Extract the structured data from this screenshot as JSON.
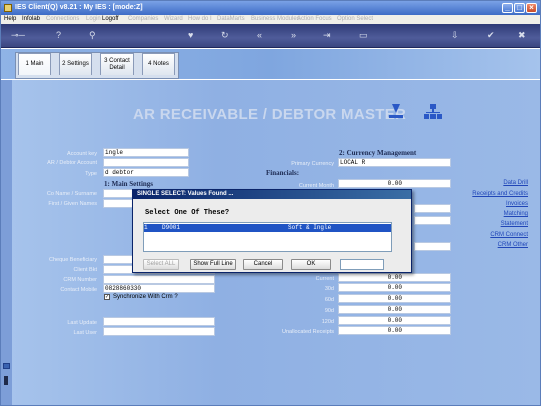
{
  "window": {
    "title": "IES Client(Q) v8.21 : My IES :     [mode:Z]"
  },
  "menu": {
    "items": [
      {
        "label": "Help",
        "enabled": true
      },
      {
        "label": "Infolab",
        "enabled": true
      },
      {
        "label": "Connections",
        "enabled": false
      },
      {
        "label": "Login",
        "enabled": false
      },
      {
        "label": "Logoff",
        "enabled": true
      },
      {
        "label": "Companies",
        "enabled": false
      },
      {
        "label": "Wizard",
        "enabled": false
      },
      {
        "label": "How do I",
        "enabled": false
      },
      {
        "label": "DataMarts",
        "enabled": false
      },
      {
        "label": "Business Modules",
        "enabled": false
      },
      {
        "label": "Action Focus",
        "enabled": false
      },
      {
        "label": "Option Select",
        "enabled": false
      }
    ]
  },
  "tabs": [
    {
      "label": "1 Main"
    },
    {
      "label": "2 Settings"
    },
    {
      "label": "3 Contact Detail"
    },
    {
      "label": "4 Notes"
    }
  ],
  "page": {
    "title": "AR RECEIVABLE / DEBTOR MASTER"
  },
  "left": {
    "account_key_label": "Account key",
    "account_key_value": "ingle",
    "debtor_account_label": "AR / Debtor Account",
    "type_label": "Type",
    "type_value": "d debtor",
    "section_main": "1: Main Settings",
    "co_name_label": "Co Name / Surname",
    "first_name_label": "First / Given Names",
    "cheque_beneficiary_label": "Cheque Beneficiary",
    "client_bkt_label": "Client Bkt",
    "crm_number_label": "CRM Number",
    "contact_mobile_label": "Contact Mobile",
    "contact_mobile_value": "0828860330",
    "sync_crm_label": "Synchronize With Crm ?",
    "sync_crm_checked": true,
    "last_update_label": "Last Update",
    "last_user_label": "Last User"
  },
  "right": {
    "section_currency": "2: Currency Management",
    "primary_currency_label": "Primary Currency",
    "primary_currency_value": "LOCAL R",
    "section_financials": "Financials:",
    "current_month_label": "Current Month",
    "current_month_value": "0.00",
    "current_label": "Current",
    "current_value": "0.00",
    "d30_label": "30d",
    "d30_value": "0.00",
    "d60_label": "60d",
    "d60_value": "0.00",
    "d90_label": "90d",
    "d90_value": "0.00",
    "d120_label": "120d",
    "d120_value": "0.00",
    "unallocated_label": "Unallocated Receipts",
    "unallocated_value": "0.00"
  },
  "links": [
    "Data Drill",
    "Receipts and Credits",
    "Invoices",
    "Matching",
    "Statement",
    "CRM Connect",
    "CRM Other"
  ],
  "dialog": {
    "title": "SINGLE SELECT: Values Found ...",
    "prompt": "Select One Of These?",
    "rows": [
      {
        "text": "1    D9001                              Soft & Ingle"
      }
    ],
    "buttons": {
      "select_all": "Select ALL",
      "show_full_line": "Show Full Line",
      "cancel": "Cancel",
      "ok": "OK"
    }
  },
  "colors": {
    "titlebar": "#3e6cc6",
    "toolbar": "#2f3b76",
    "content": "#9ab9e7",
    "selection": "#2054c4",
    "link": "#2046b8"
  }
}
